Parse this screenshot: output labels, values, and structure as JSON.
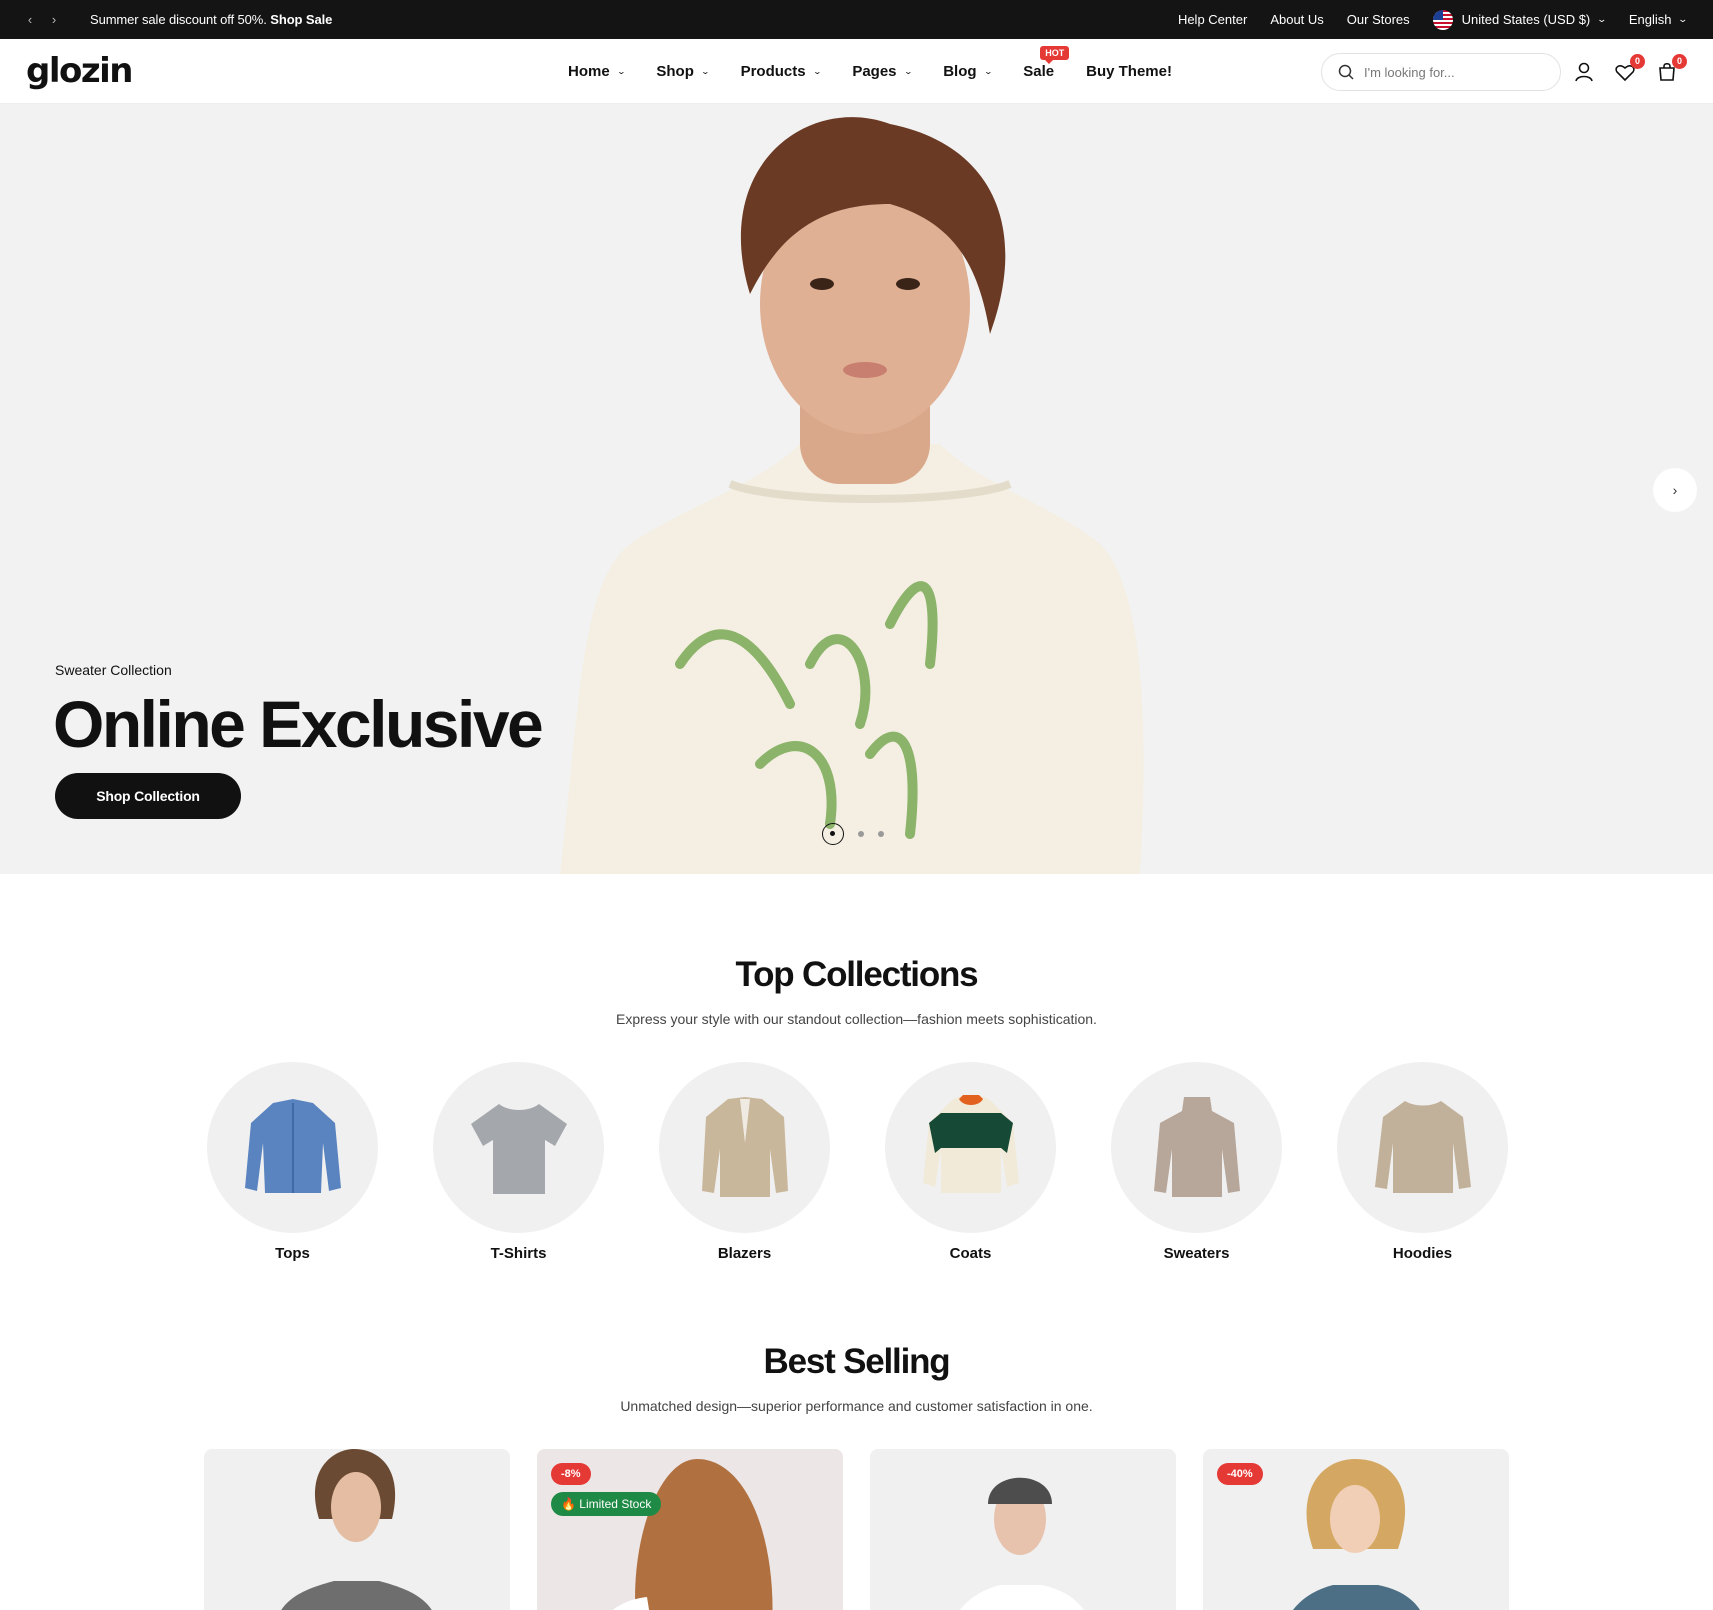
{
  "announcement": {
    "prev_icon": "chevron-left-icon",
    "next_icon": "chevron-right-icon",
    "promo_text": "Summer sale discount off 50%. ",
    "promo_link": "Shop Sale",
    "links": [
      "Help Center",
      "About Us",
      "Our Stores"
    ],
    "currency": "United States (USD $)",
    "language": "English"
  },
  "header": {
    "logo": "glozin",
    "nav": [
      {
        "label": "Home",
        "dropdown": true
      },
      {
        "label": "Shop",
        "dropdown": true
      },
      {
        "label": "Products",
        "dropdown": true
      },
      {
        "label": "Pages",
        "dropdown": true
      },
      {
        "label": "Blog",
        "dropdown": true
      },
      {
        "label": "Sale",
        "dropdown": false,
        "badge": "HOT"
      },
      {
        "label": "Buy Theme!",
        "dropdown": false
      }
    ],
    "search_placeholder": "I'm looking for...",
    "wishlist_count": "0",
    "cart_count": "0"
  },
  "hero": {
    "subtitle": "Sweater Collection",
    "title": "Online Exclusive",
    "button": "Shop Collection",
    "slide_count": 3,
    "active_slide": 1
  },
  "top_collections": {
    "title": "Top Collections",
    "subtitle": "Express your style with our standout collection—fashion meets sophistication.",
    "items": [
      "Tops",
      "T-Shirts",
      "Blazers",
      "Coats",
      "Sweaters",
      "Hoodies"
    ]
  },
  "best_selling": {
    "title": "Best Selling",
    "subtitle": "Unmatched design—superior performance and customer satisfaction in one.",
    "products": [
      {
        "discount": "",
        "stock": ""
      },
      {
        "discount": "-8%",
        "stock": "Limited Stock"
      },
      {
        "discount": "",
        "stock": ""
      },
      {
        "discount": "-40%",
        "stock": ""
      }
    ]
  },
  "colors": {
    "topbar_bg": "#141414",
    "accent_red": "#e53935",
    "stock_green": "#1e8a45",
    "hero_bg": "#f2f2f2"
  }
}
